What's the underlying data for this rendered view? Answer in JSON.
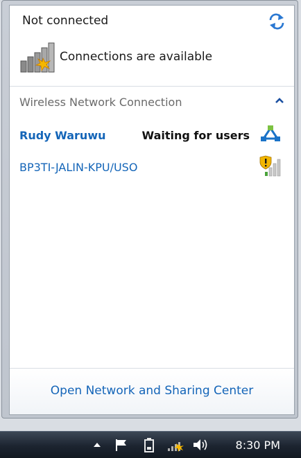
{
  "popup": {
    "title": "Not connected",
    "availability_text": "Connections are available",
    "section_label": "Wireless Network Connection",
    "networks": [
      {
        "name": "Rudy Waruwu",
        "status": "Waiting for users",
        "icon": "adhoc-network-icon"
      },
      {
        "name": "BP3TI-JALIN-KPU/USO",
        "status": "",
        "icon": "secured-signal-icon"
      }
    ],
    "footer_link": "Open Network and Sharing Center"
  },
  "taskbar": {
    "clock": "8:30 PM",
    "icons": [
      "show-hidden-icons-icon",
      "action-center-flag-icon",
      "battery-icon",
      "network-icon",
      "volume-icon"
    ]
  },
  "colors": {
    "link": "#1465b8",
    "accent_blue": "#1a73c8",
    "taskbar": "#1c2430"
  }
}
